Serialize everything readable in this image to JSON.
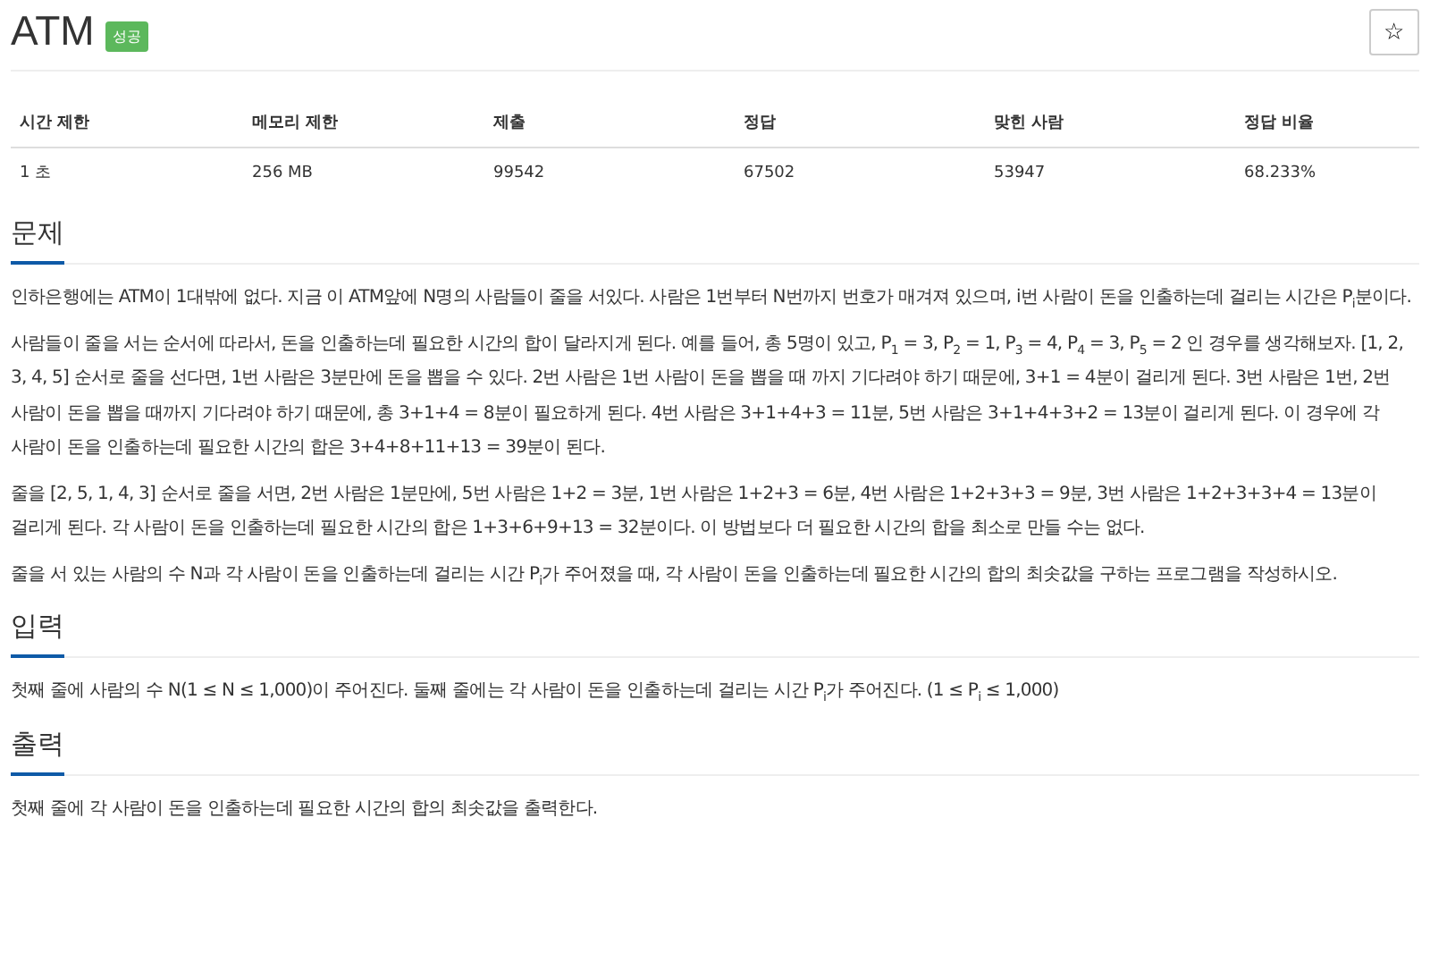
{
  "title": "ATM",
  "badge": "성공",
  "star_button": "☆",
  "table": {
    "columns": [
      "시간 제한",
      "메모리 제한",
      "제출",
      "정답",
      "맞힌 사람",
      "정답 비율"
    ],
    "rows": [
      [
        "1 초",
        "256 MB",
        "99542",
        "67502",
        "53947",
        "68.233%"
      ]
    ]
  },
  "sections": [
    {
      "heading": "문제",
      "paragraphs": [
        "인하은행에는 ATM이 1대밖에 없다. 지금 이 ATM앞에 N명의 사람들이 줄을 서있다. 사람은 1번부터 N번까지 번호가 매겨져 있으며, i번 사람이 돈을 인출하는데 걸리는 시간은 P$_{i}$분이다.",
        "사람들이 줄을 서는 순서에 따라서, 돈을 인출하는데 필요한 시간의 합이 달라지게 된다. 예를 들어, 총 5명이 있고, P$_{1}$ = 3, P$_{2}$ = 1, P$_{3}$ = 4, P$_{4}$ = 3, P$_{5}$ = 2 인 경우를 생각해보자. [1, 2, 3, 4, 5] 순서로 줄을 선다면, 1번 사람은 3분만에 돈을 뽑을 수 있다. 2번 사람은 1번 사람이 돈을 뽑을 때 까지 기다려야 하기 때문에, 3+1 = 4분이 걸리게 된다. 3번 사람은 1번, 2번 사람이 돈을 뽑을 때까지 기다려야 하기 때문에, 총 3+1+4 = 8분이 필요하게 된다. 4번 사람은 3+1+4+3 = 11분, 5번 사람은 3+1+4+3+2 = 13분이 걸리게 된다. 이 경우에 각 사람이 돈을 인출하는데 필요한 시간의 합은 3+4+8+11+13 = 39분이 된다.",
        "줄을 [2, 5, 1, 4, 3] 순서로 줄을 서면, 2번 사람은 1분만에, 5번 사람은 1+2 = 3분, 1번 사람은 1+2+3 = 6분, 4번 사람은 1+2+3+3 = 9분, 3번 사람은 1+2+3+3+4 = 13분이 걸리게 된다. 각 사람이 돈을 인출하는데 필요한 시간의 합은 1+3+6+9+13 = 32분이다. 이 방법보다 더 필요한 시간의 합을 최소로 만들 수는 없다.",
        "줄을 서 있는 사람의 수 N과 각 사람이 돈을 인출하는데 걸리는 시간 P$_{i}$가 주어졌을 때, 각 사람이 돈을 인출하는데 필요한 시간의 합의 최솟값을 구하는 프로그램을 작성하시오."
      ]
    },
    {
      "heading": "입력",
      "paragraphs": [
        "첫째 줄에 사람의 수 N(1 ≤ N ≤ 1,000)이 주어진다. 둘째 줄에는 각 사람이 돈을 인출하는데 걸리는 시간 P$_{i}$가 주어진다. (1 ≤ P$_{i}$ ≤ 1,000)"
      ]
    },
    {
      "heading": "출력",
      "paragraphs": [
        "첫째 줄에 각 사람이 돈을 인출하는데 필요한 시간의 합의 최솟값을 출력한다."
      ]
    }
  ]
}
